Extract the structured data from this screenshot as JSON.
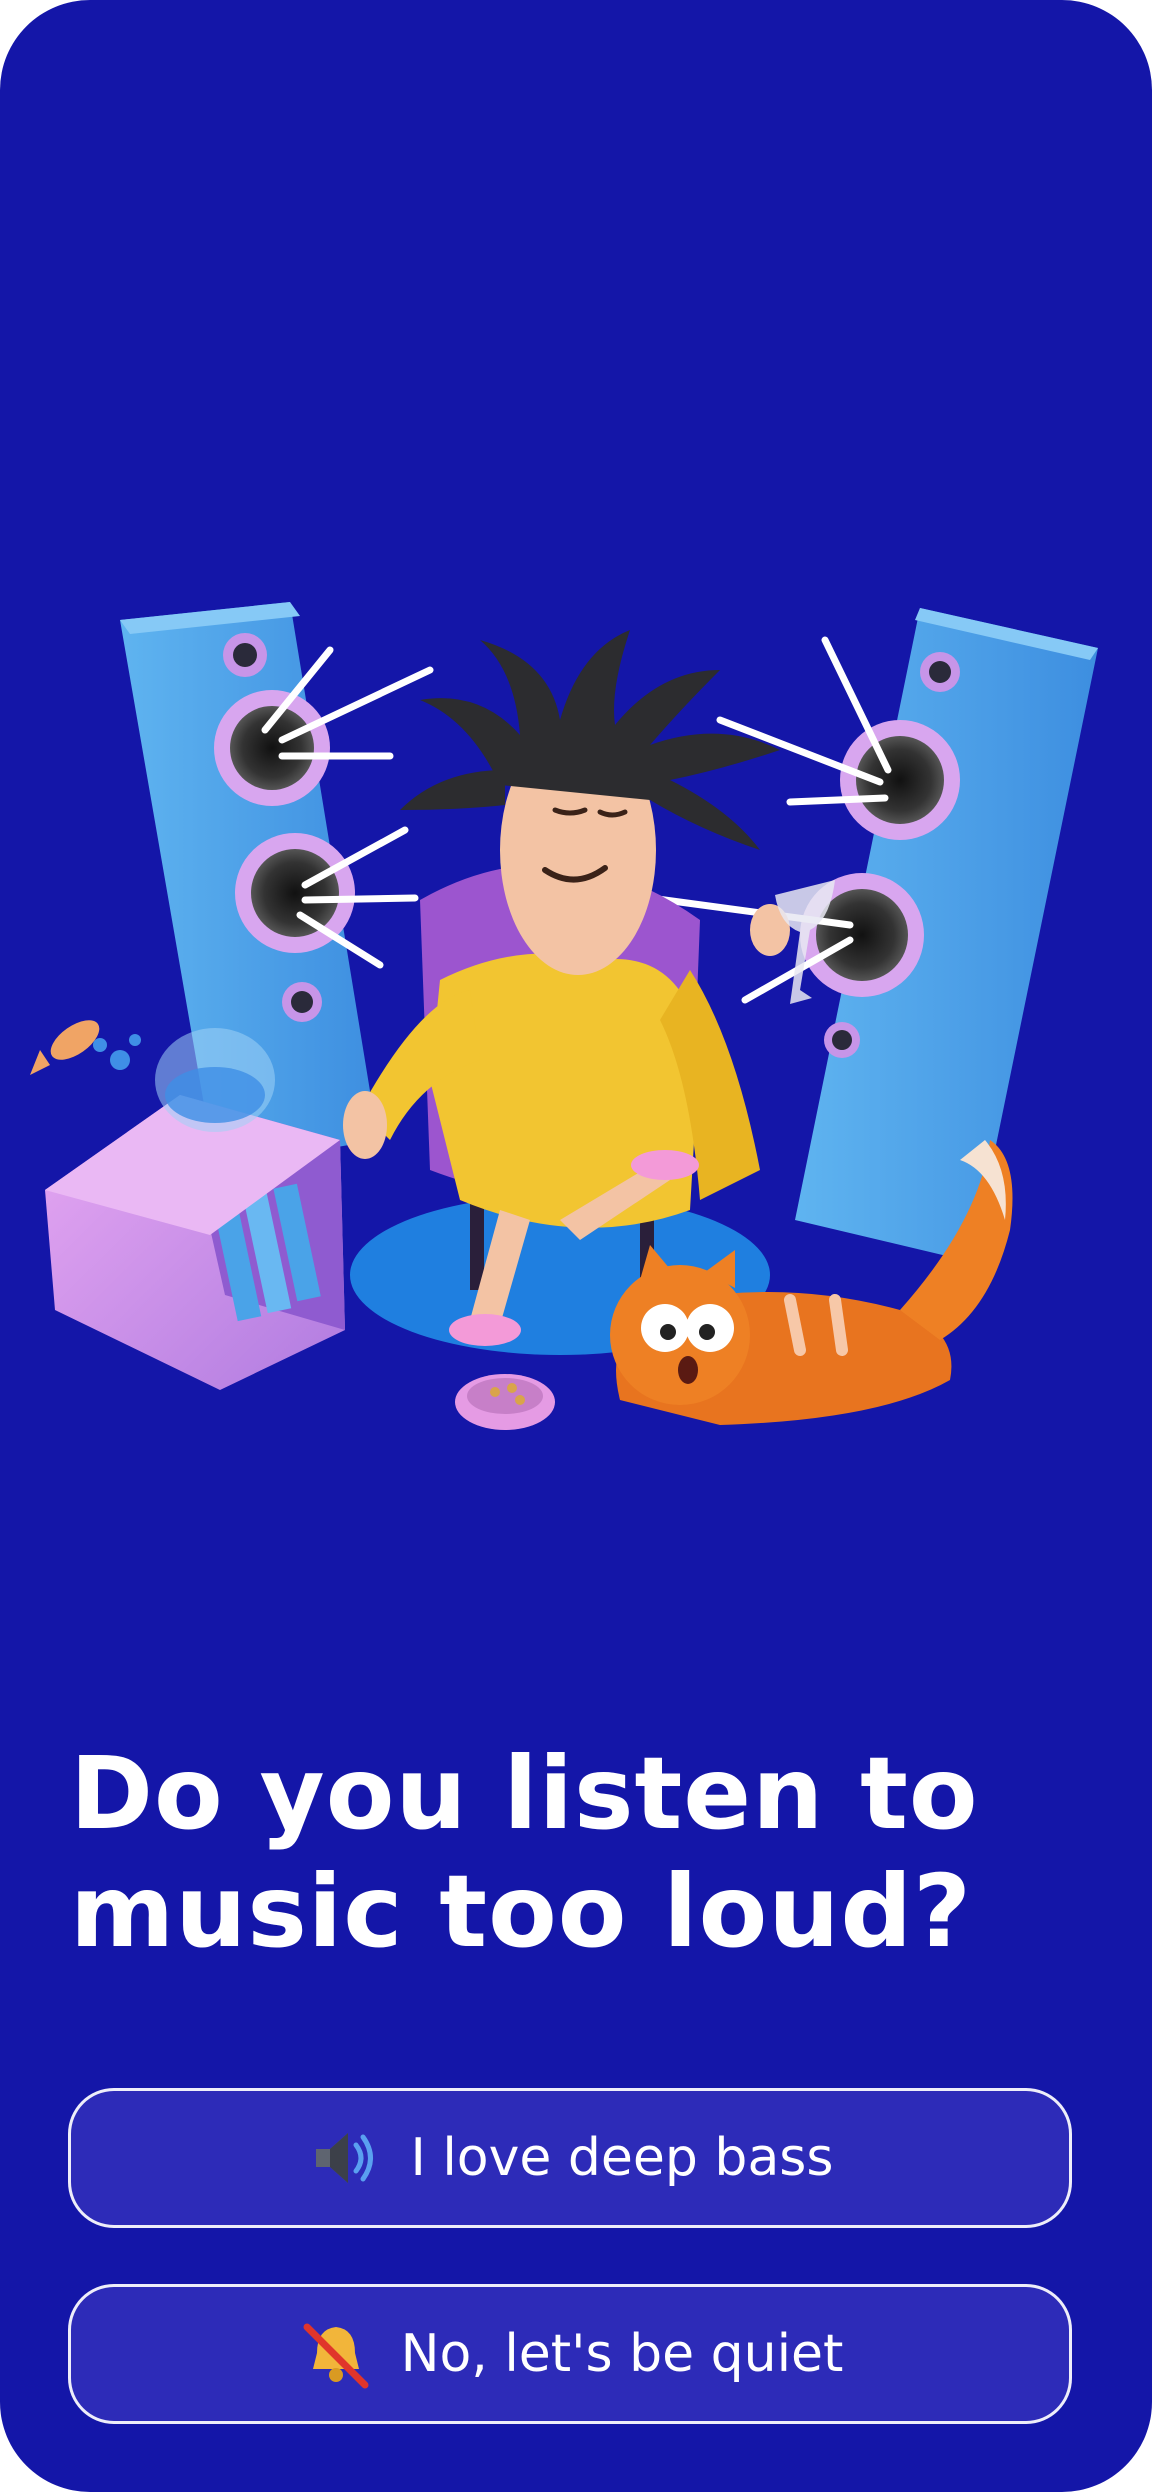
{
  "onboarding": {
    "question": "Do you listen to music too loud?",
    "answers": [
      {
        "icon": "speaker-loud-icon",
        "label": "I love deep bass"
      },
      {
        "icon": "muted-bell-icon",
        "label": "No, let's be quiet"
      }
    ]
  },
  "colors": {
    "background": "#1416a8",
    "button_fill": "#2d2bb8",
    "button_border": "#ffffff",
    "text": "#ffffff"
  }
}
